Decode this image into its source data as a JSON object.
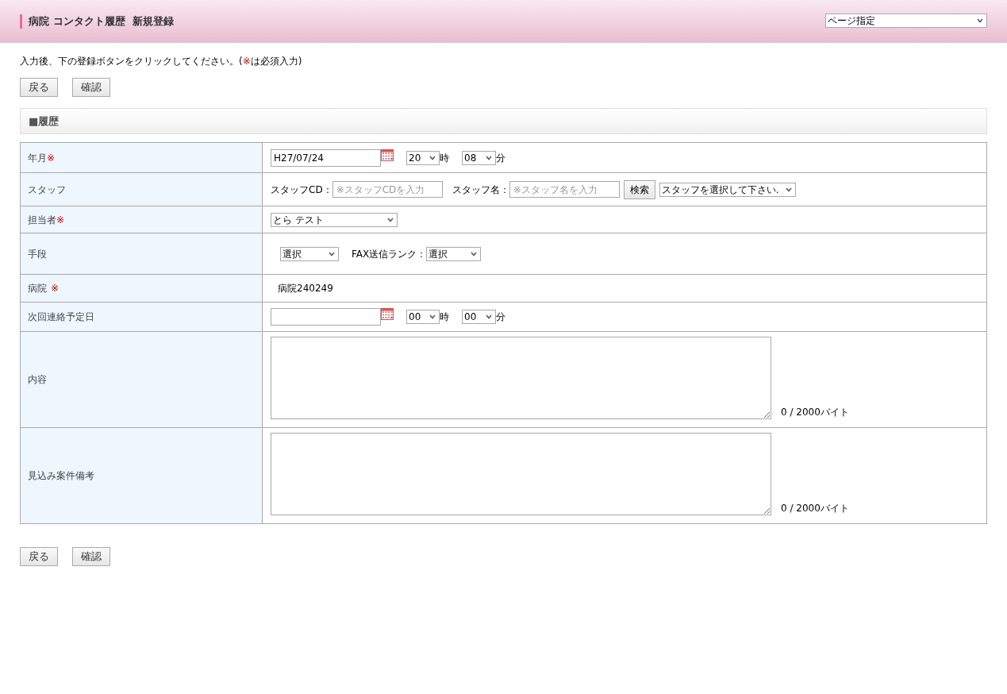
{
  "header": {
    "title": "病院 コンタクト履歴  新規登録",
    "page_select": "ページ指定"
  },
  "instruction": {
    "before": "入力後、下の登録ボタンをクリックしてください。(",
    "mark": "※",
    "after": "は必須入力)"
  },
  "top_buttons": [
    "戻る",
    "確認"
  ],
  "section_title": "■履歴",
  "rows": [
    {
      "kind": "datetime",
      "label": "年月",
      "required_mark": "※",
      "date": "H27/07/24",
      "hour": "20",
      "hour_unit": "時",
      "minute": "08",
      "minute_unit": "分"
    },
    {
      "kind": "staff",
      "label": "スタッフ",
      "cd_label": "スタッフCD：",
      "cd_placeholder": "※スタッフCDを入力",
      "name_label": "スタッフ名：",
      "name_placeholder": "※スタッフ名を入力",
      "search_button": "検索",
      "staff_select": "スタッフを選択して下さい."
    },
    {
      "kind": "select",
      "label": "担当者",
      "required_mark": "※",
      "value": "とら テスト"
    },
    {
      "kind": "method",
      "label": "手段",
      "method_select": "選択",
      "rank_label": "FAX送信ランク：",
      "rank_select": "選択"
    },
    {
      "kind": "text",
      "label": "病院",
      "required_mark": "※",
      "value": "病院240249"
    },
    {
      "kind": "datetime",
      "label": "次回連絡予定日",
      "hour": "00",
      "hour_unit": "時",
      "minute": "00",
      "minute_unit": "分"
    },
    {
      "kind": "textarea",
      "label": "内容",
      "counter": "0 / 2000バイト"
    },
    {
      "kind": "textarea",
      "label": "見込み案件備考",
      "counter": "0 / 2000バイト"
    }
  ],
  "bottom_buttons": [
    "戻る",
    "確認"
  ]
}
